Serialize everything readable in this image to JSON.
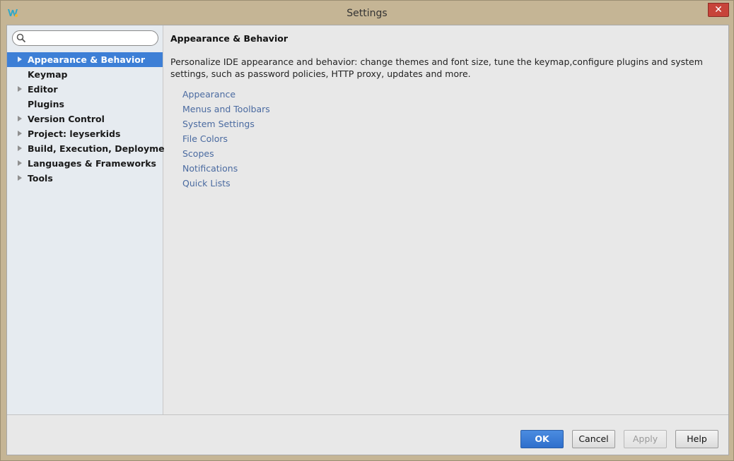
{
  "window": {
    "title": "Settings",
    "close_glyph": "✕"
  },
  "search": {
    "placeholder": "",
    "value": ""
  },
  "sidebar": {
    "items": [
      {
        "label": "Appearance & Behavior",
        "expandable": true,
        "selected": true
      },
      {
        "label": "Keymap",
        "expandable": false,
        "selected": false
      },
      {
        "label": "Editor",
        "expandable": true,
        "selected": false
      },
      {
        "label": "Plugins",
        "expandable": false,
        "selected": false
      },
      {
        "label": "Version Control",
        "expandable": true,
        "selected": false
      },
      {
        "label": "Project: leyserkids",
        "expandable": true,
        "selected": false
      },
      {
        "label": "Build, Execution, Deployment",
        "expandable": true,
        "selected": false
      },
      {
        "label": "Languages & Frameworks",
        "expandable": true,
        "selected": false
      },
      {
        "label": "Tools",
        "expandable": true,
        "selected": false
      }
    ]
  },
  "content": {
    "title": "Appearance & Behavior",
    "description": "Personalize IDE appearance and behavior: change themes and font size, tune the keymap,configure plugins and system settings, such as password policies, HTTP proxy, updates and more.",
    "links": [
      "Appearance",
      "Menus and Toolbars",
      "System Settings",
      "File Colors",
      "Scopes",
      "Notifications",
      "Quick Lists"
    ]
  },
  "buttons": {
    "ok": "OK",
    "cancel": "Cancel",
    "apply": "Apply",
    "help": "Help"
  },
  "colors": {
    "selection": "#3d7fd6",
    "link": "#4a6aa0",
    "close_button": "#c7443a"
  }
}
